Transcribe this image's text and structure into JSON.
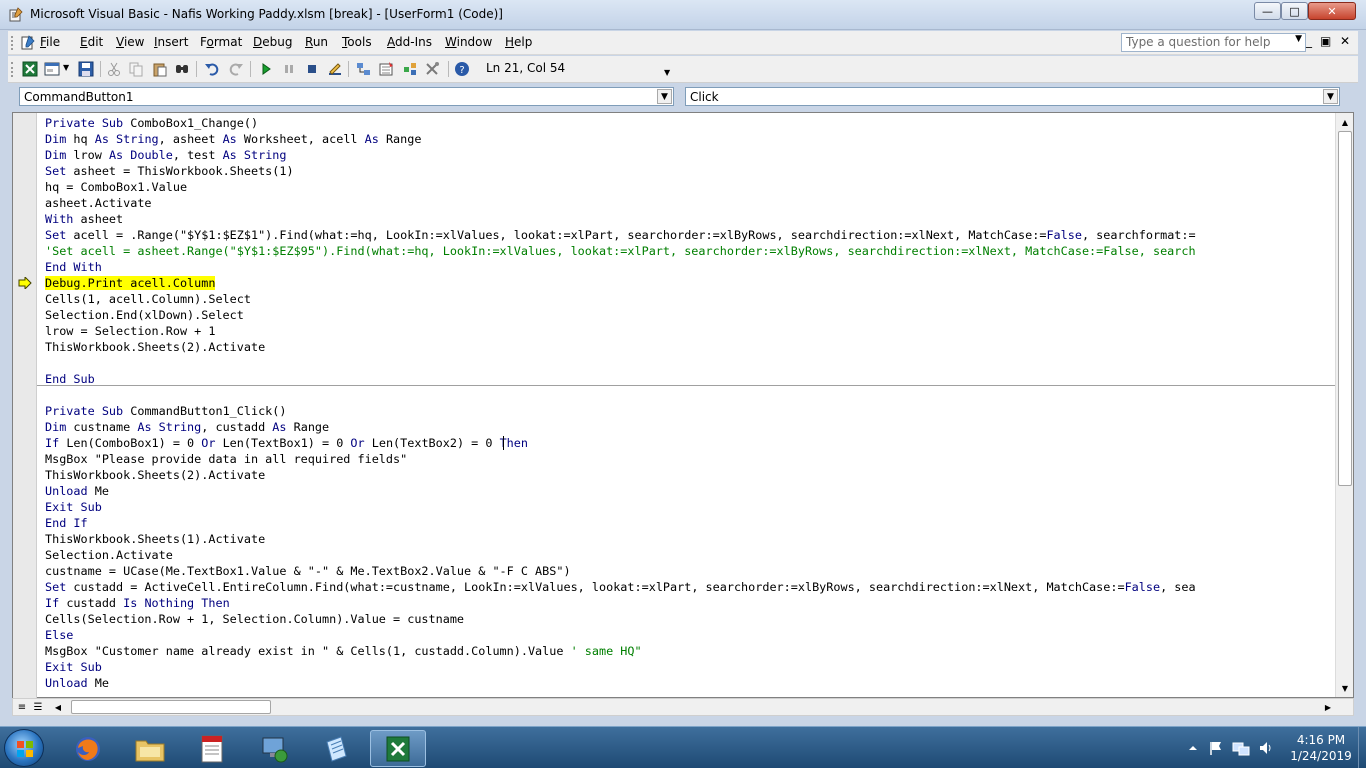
{
  "window": {
    "title": "Microsoft Visual Basic - Nafis Working Paddy.xlsm [break] - [UserForm1 (Code)]",
    "controls": {
      "minimize": "—",
      "maximize": "□",
      "close": "✕"
    }
  },
  "menu": {
    "items": [
      {
        "label": "File",
        "mnemonic": "F"
      },
      {
        "label": "Edit",
        "mnemonic": "E"
      },
      {
        "label": "View",
        "mnemonic": "V"
      },
      {
        "label": "Insert",
        "mnemonic": "I"
      },
      {
        "label": "Format",
        "mnemonic": "o"
      },
      {
        "label": "Debug",
        "mnemonic": "D"
      },
      {
        "label": "Run",
        "mnemonic": "R"
      },
      {
        "label": "Tools",
        "mnemonic": "T"
      },
      {
        "label": "Add-Ins",
        "mnemonic": "A"
      },
      {
        "label": "Window",
        "mnemonic": "W"
      },
      {
        "label": "Help",
        "mnemonic": "H"
      }
    ],
    "help_placeholder": "Type a question for help",
    "doc_controls": {
      "minimize": "_",
      "restore": "▣",
      "close": "✕"
    }
  },
  "toolbar": {
    "position": "Ln 21, Col 54",
    "icons": [
      "excel-icon",
      "insert-userform-icon",
      "save-icon",
      "cut-icon",
      "copy-icon",
      "paste-icon",
      "find-icon",
      "undo-icon",
      "redo-icon",
      "run-icon",
      "break-icon",
      "reset-icon",
      "design-mode-icon",
      "project-explorer-icon",
      "properties-icon",
      "object-browser-icon",
      "toolbox-icon",
      "help-icon"
    ]
  },
  "editor": {
    "object_combo": "CommandButton1",
    "procedure_combo": "Click",
    "current_line": 11,
    "lines": [
      [
        {
          "t": "Private Sub ",
          "c": "kw"
        },
        {
          "t": "ComboBox1_Change()"
        }
      ],
      [
        {
          "t": "Dim ",
          "c": "kw"
        },
        {
          "t": "hq "
        },
        {
          "t": "As String",
          "c": "kw"
        },
        {
          "t": ", asheet "
        },
        {
          "t": "As ",
          "c": "kw"
        },
        {
          "t": "Worksheet, acell "
        },
        {
          "t": "As ",
          "c": "kw"
        },
        {
          "t": "Range"
        }
      ],
      [
        {
          "t": "Dim ",
          "c": "kw"
        },
        {
          "t": "lrow "
        },
        {
          "t": "As Double",
          "c": "kw"
        },
        {
          "t": ", test "
        },
        {
          "t": "As String",
          "c": "kw"
        }
      ],
      [
        {
          "t": "Set ",
          "c": "kw"
        },
        {
          "t": "asheet = ThisWorkbook.Sheets(1)"
        }
      ],
      [
        {
          "t": "hq = ComboBox1.Value"
        }
      ],
      [
        {
          "t": "asheet.Activate"
        }
      ],
      [
        {
          "t": "With ",
          "c": "kw"
        },
        {
          "t": "asheet"
        }
      ],
      [
        {
          "t": "Set ",
          "c": "kw"
        },
        {
          "t": "acell = .Range(\"$Y$1:$EZ$1\").Find(what:=hq, LookIn:=xlValues, lookat:=xlPart, searchorder:=xlByRows, searchdirection:=xlNext, MatchCase:="
        },
        {
          "t": "False",
          "c": "kw"
        },
        {
          "t": ", searchformat:="
        }
      ],
      [
        {
          "t": "'Set acell = asheet.Range(\"$Y$1:$EZ$95\").Find(what:=hq, LookIn:=xlValues, lookat:=xlPart, searchorder:=xlByRows, searchdirection:=xlNext, MatchCase:=False, search",
          "c": "cm"
        }
      ],
      [
        {
          "t": "End With",
          "c": "kw"
        }
      ],
      [
        {
          "t": "Debug.Print acell.Column",
          "c": "hl"
        }
      ],
      [
        {
          "t": "Cells(1, acell.Column).Select"
        }
      ],
      [
        {
          "t": "Selection.End(xlDown).Select"
        }
      ],
      [
        {
          "t": "lrow = Selection.Row + 1"
        }
      ],
      [
        {
          "t": "ThisWorkbook.Sheets(2).Activate"
        }
      ],
      [],
      [
        {
          "t": "End Sub",
          "c": "kw"
        }
      ],
      [],
      [
        {
          "t": "Private Sub ",
          "c": "kw"
        },
        {
          "t": "CommandButton1_Click()"
        }
      ],
      [
        {
          "t": "Dim ",
          "c": "kw"
        },
        {
          "t": "custname "
        },
        {
          "t": "As String",
          "c": "kw"
        },
        {
          "t": ", custadd "
        },
        {
          "t": "As ",
          "c": "kw"
        },
        {
          "t": "Range"
        }
      ],
      [
        {
          "t": "If ",
          "c": "kw"
        },
        {
          "t": "Len(ComboBox1) = 0 "
        },
        {
          "t": "Or ",
          "c": "kw"
        },
        {
          "t": "Len(TextBox1) = 0 "
        },
        {
          "t": "Or ",
          "c": "kw"
        },
        {
          "t": "Len(TextBox2) = 0 "
        },
        {
          "t": "Then",
          "c": "kw"
        }
      ],
      [
        {
          "t": "MsgBox \"Please provide data in all required fields\""
        }
      ],
      [
        {
          "t": "ThisWorkbook.Sheets(2).Activate"
        }
      ],
      [
        {
          "t": "Unload ",
          "c": "kw"
        },
        {
          "t": "Me"
        }
      ],
      [
        {
          "t": "Exit Sub",
          "c": "kw"
        }
      ],
      [
        {
          "t": "End If",
          "c": "kw"
        }
      ],
      [
        {
          "t": "ThisWorkbook.Sheets(1).Activate"
        }
      ],
      [
        {
          "t": "Selection.Activate"
        }
      ],
      [
        {
          "t": "custname = UCase(Me.TextBox1.Value & \"-\" & Me.TextBox2.Value & \"-F C ABS\")"
        }
      ],
      [
        {
          "t": "Set ",
          "c": "kw"
        },
        {
          "t": "custadd = ActiveCell.EntireColumn.Find(what:=custname, LookIn:=xlValues, lookat:=xlPart, searchorder:=xlByRows, searchdirection:=xlNext, MatchCase:="
        },
        {
          "t": "False",
          "c": "kw"
        },
        {
          "t": ", sea"
        }
      ],
      [
        {
          "t": "If ",
          "c": "kw"
        },
        {
          "t": "custadd "
        },
        {
          "t": "Is Nothing Then",
          "c": "kw"
        }
      ],
      [
        {
          "t": "Cells(Selection.Row + 1, Selection.Column).Value = custname"
        }
      ],
      [
        {
          "t": "Else",
          "c": "kw"
        }
      ],
      [
        {
          "t": "MsgBox \"Customer name already exist in \" & Cells(1, custadd.Column).Value "
        },
        {
          "t": "' same HQ\"",
          "c": "cm"
        }
      ],
      [
        {
          "t": "Exit Sub",
          "c": "kw"
        }
      ],
      [
        {
          "t": "Unload ",
          "c": "kw"
        },
        {
          "t": "Me"
        }
      ]
    ]
  },
  "taskbar": {
    "apps": [
      {
        "name": "firefox-taskbar-button",
        "icon": "firefox-icon"
      },
      {
        "name": "explorer-taskbar-button",
        "icon": "folder-icon"
      },
      {
        "name": "tally-taskbar-button",
        "icon": "tally-erp-icon",
        "label": "Tally ERP 9"
      },
      {
        "name": "network-taskbar-button",
        "icon": "computer-network-icon"
      },
      {
        "name": "notepad-taskbar-button",
        "icon": "notepad-icon"
      },
      {
        "name": "excel-taskbar-button",
        "icon": "excel-icon",
        "active": true
      }
    ],
    "time": "4:16 PM",
    "date": "1/24/2019"
  }
}
